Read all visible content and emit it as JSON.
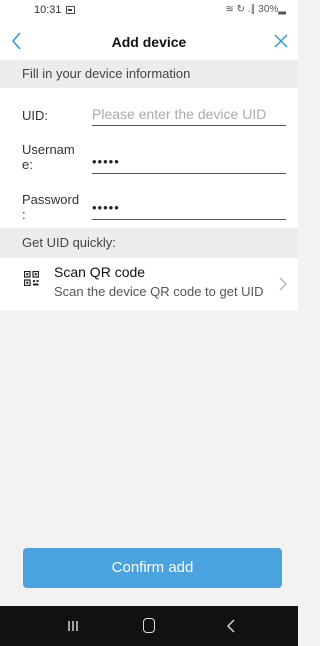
{
  "status_bar": {
    "time": "10:31",
    "right_text": "≋ ↻ .∥ 30%▂"
  },
  "nav": {
    "title": "Add device",
    "back_icon": "chevron-left-icon",
    "close_icon": "close-icon"
  },
  "info_section": {
    "header": "Fill in your device information"
  },
  "form": {
    "uid": {
      "label": "UID:",
      "value": "",
      "placeholder": "Please enter the device UID"
    },
    "username": {
      "label_line1": "Usernam",
      "label_line2": "e:",
      "value": "•••••"
    },
    "password": {
      "label_line1": "Password",
      "label_line2": ":",
      "value": "•••••"
    }
  },
  "uid_section": {
    "header": "Get UID quickly:"
  },
  "scan": {
    "title": "Scan QR code",
    "subtitle": "Scan the device QR code to get UID",
    "icon": "qr-code-icon"
  },
  "confirm": {
    "label": "Confirm add"
  },
  "colors": {
    "accent": "#4aa3df",
    "background": "#f2f2f2",
    "nav_bar": "#111111"
  }
}
